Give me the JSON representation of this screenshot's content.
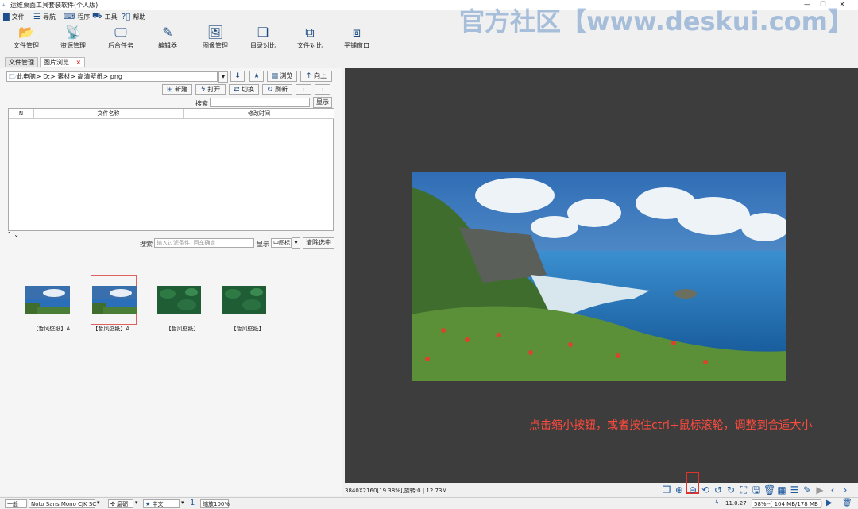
{
  "window": {
    "title": "运维桌面工具套装软件(个人版)",
    "watermark": "官方社区【www.deskui.com】"
  },
  "menu": [
    {
      "label": "文件",
      "icon": "file-icon"
    },
    {
      "label": "导航",
      "icon": "menu-icon"
    },
    {
      "label": "程序",
      "icon": "keyboard-icon"
    },
    {
      "label": "工具",
      "icon": "toolbox-icon"
    },
    {
      "label": "帮助",
      "icon": "help-icon"
    }
  ],
  "toolbar": [
    {
      "label": "文件管理",
      "icon": "folder-icon"
    },
    {
      "label": "资源管理",
      "icon": "satellite-icon"
    },
    {
      "label": "后台任务",
      "icon": "monitor-icon"
    },
    {
      "label": "编辑器",
      "icon": "edit-icon"
    },
    {
      "label": "图像管理",
      "icon": "image-icon"
    },
    {
      "label": "目录对比",
      "icon": "copy-icon"
    },
    {
      "label": "文件对比",
      "icon": "file-compare-icon"
    },
    {
      "label": "平铺窗口",
      "icon": "windows-icon"
    }
  ],
  "tabs": [
    {
      "label": "文件管理",
      "active": false
    },
    {
      "label": "图片浏览",
      "active": true,
      "close": "×"
    }
  ],
  "browser": {
    "path": "此电脑> D:> 素材> 高清壁纸> png",
    "browse_label": "浏览",
    "up_label": "向上",
    "new_label": "新建",
    "open_label": "打开",
    "switch_label": "切换",
    "refresh_label": "刷新",
    "search_label": "搜索",
    "show_label": "显示",
    "columns": [
      "N",
      "文件名称",
      "修改时间"
    ],
    "filter_label": "搜索",
    "filter_placeholder": "输入过滤条件, 回车确定",
    "display_label": "显示",
    "icon_size": "中图标",
    "clear_selection": "清除选中"
  },
  "thumbnails": [
    {
      "caption": "【哲风壁纸】A...",
      "selected": false,
      "theme": "coast"
    },
    {
      "caption": "【哲风壁纸】A...",
      "selected": true,
      "theme": "coast"
    },
    {
      "caption": "【哲风壁纸】...",
      "selected": false,
      "theme": "leaves"
    },
    {
      "caption": "【哲风壁纸】...",
      "selected": false,
      "theme": "leaves"
    }
  ],
  "viewer": {
    "annotation": "点击缩小按钮，或者按住ctrl+鼠标滚轮，调整到合适大小",
    "info": "3840X2160[19.38%],旋转:0   |   12.73M"
  },
  "statusbar": {
    "mode": "一般",
    "font": "Noto Sans Mono CJK SC",
    "theme": "磨砺",
    "language": "中文",
    "page": "1",
    "zoom": "缩放100%",
    "version": "11.0.27",
    "memory": "58%--[ 104 MB/178 MB ]"
  }
}
